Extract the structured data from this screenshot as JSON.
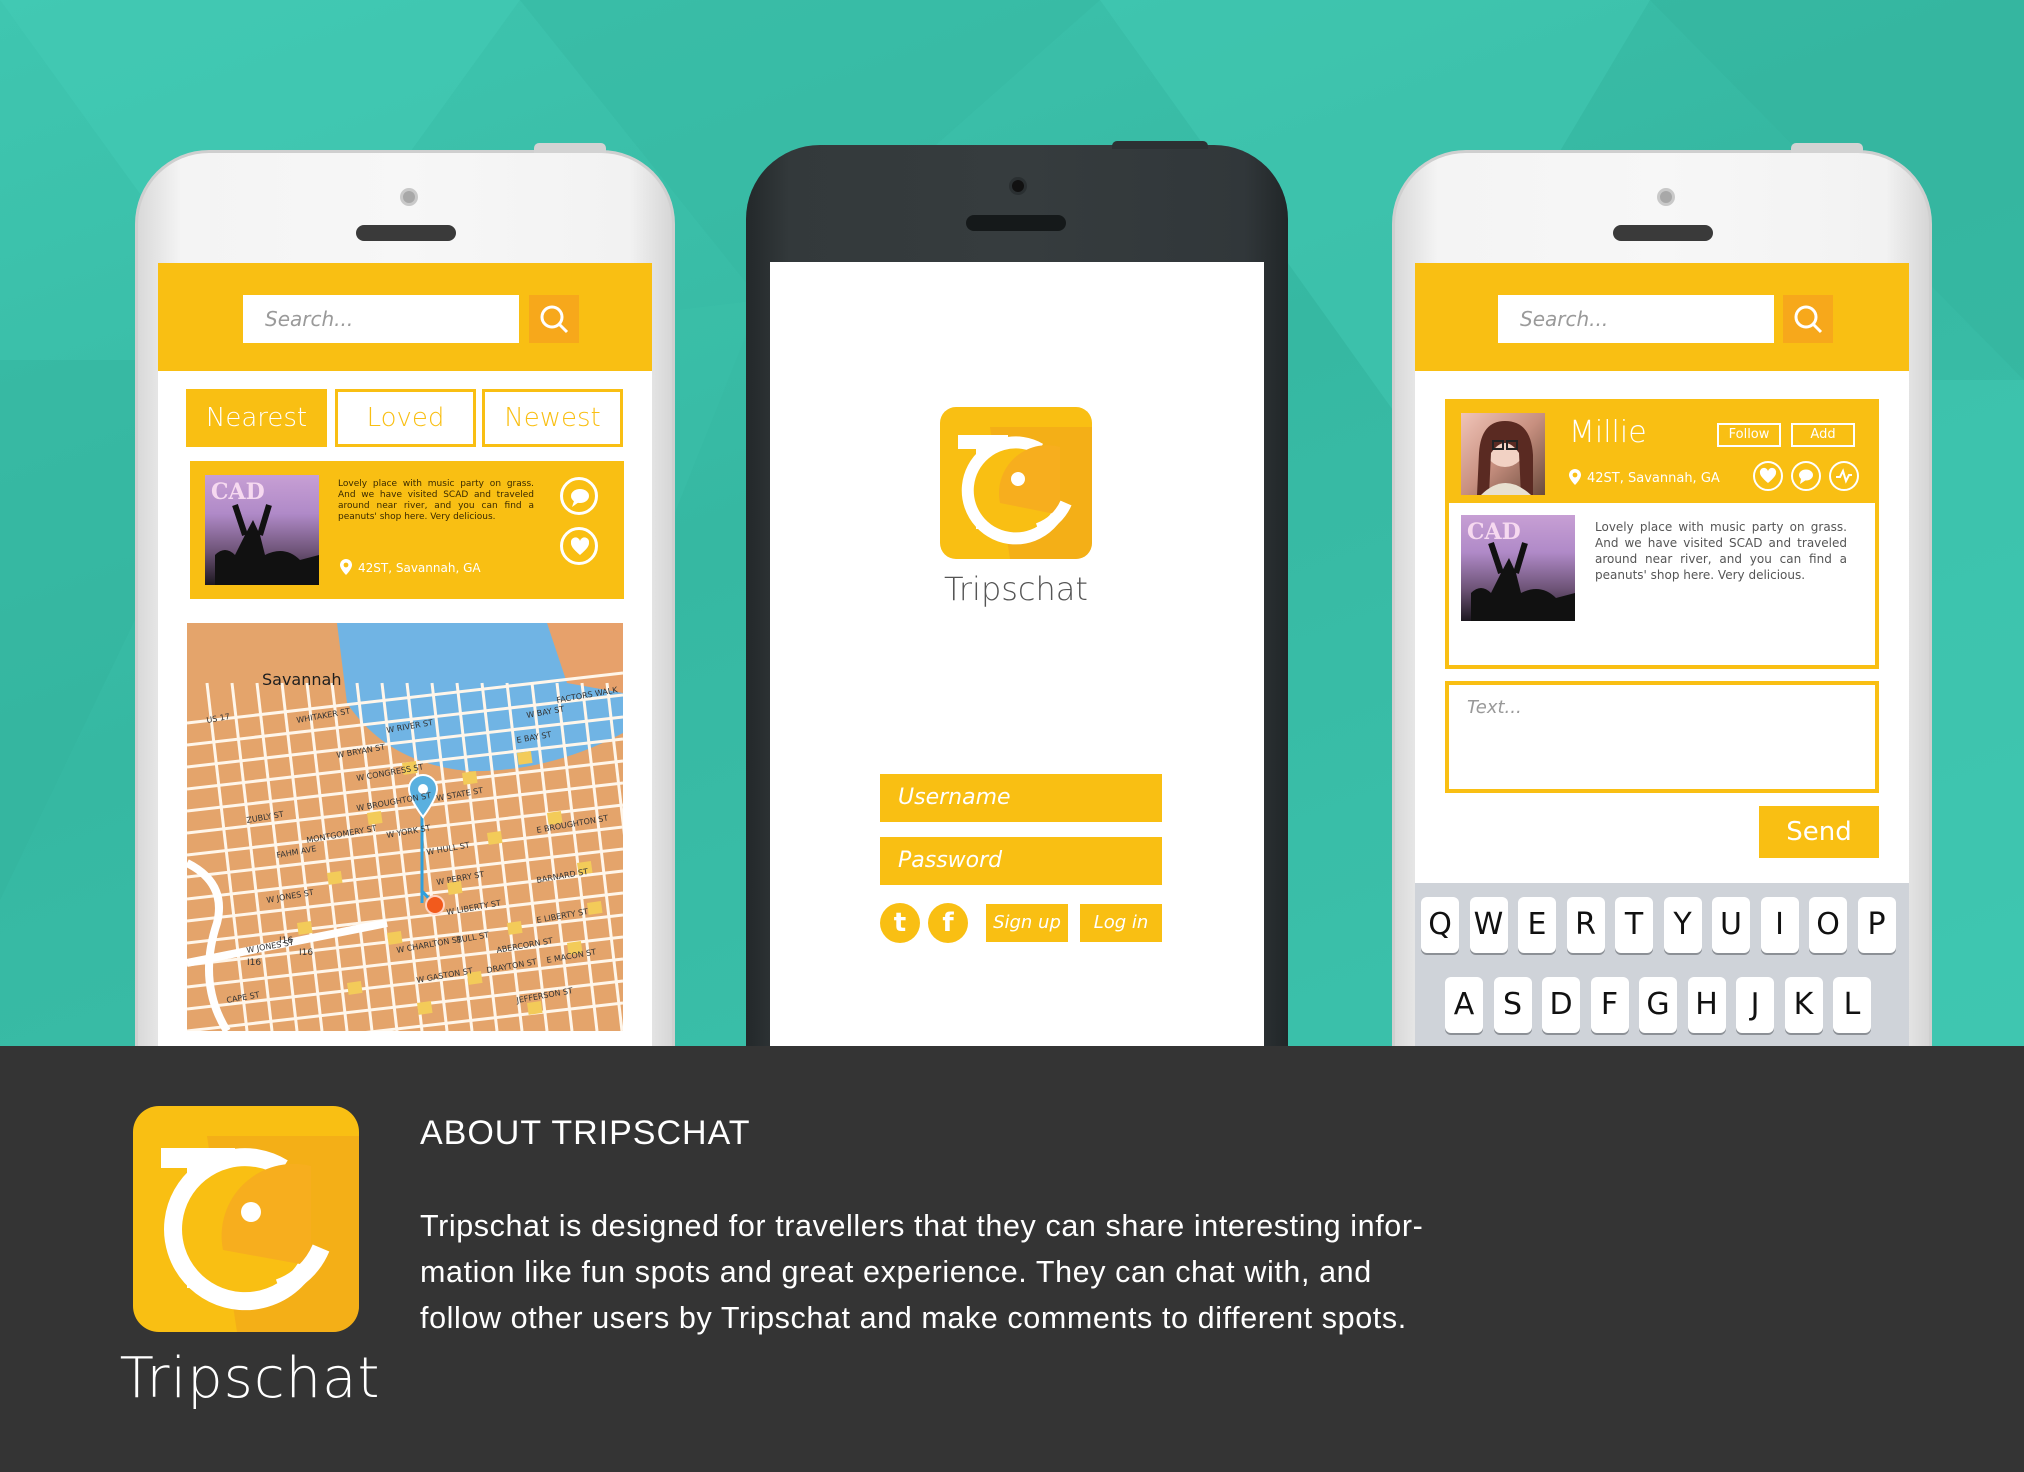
{
  "app": {
    "name": "Tripschat"
  },
  "colors": {
    "accent": "#f9bf13",
    "accent_dark": "#f7a81b",
    "background": "#3bbfaa",
    "footer": "#343434"
  },
  "left_phone": {
    "search_placeholder": "Search...",
    "tabs": [
      {
        "label": "Nearest",
        "active": true
      },
      {
        "label": "Loved",
        "active": false
      },
      {
        "label": "Newest",
        "active": false
      }
    ],
    "post": {
      "image_text": "CAD",
      "description": "Lovely place with music party on grass. And we have visited SCAD and traveled around near river, and you can find a peanuts' shop here. Very delicious.",
      "location": "42ST, Savannah, GA",
      "icons": [
        "comment-icon",
        "heart-icon"
      ]
    },
    "map": {
      "city_label": "Savannah",
      "streets": [
        "W RIVER ST",
        "W BAY ST",
        "W BRYAN ST",
        "W CONGRESS ST",
        "W BROUGHTON ST",
        "W STATE ST",
        "W YORK ST",
        "W HULL ST",
        "W PERRY ST",
        "W LIBERTY ST",
        "W JONES ST",
        "W CHARLTON ST",
        "W GASTON ST",
        "E BAY ST",
        "E BROUGHTON ST",
        "E LIBERTY ST",
        "E MACON ST",
        "FACTORS WALK",
        "BULL ST",
        "ABERCORN ST",
        "DRAYTON ST",
        "MONTGOMERY ST",
        "JEFFERSON ST",
        "BARNARD ST",
        "WHITAKER ST",
        "ZUBLY ST",
        "FAHM AVE",
        "CAPE ST",
        "W JONES ST",
        "US 17"
      ],
      "highway_labels": [
        "I16",
        "I16",
        "I16"
      ]
    }
  },
  "center_phone": {
    "app_title": "Tripschat",
    "username_placeholder": "Username",
    "password_placeholder": "Password",
    "social": {
      "twitter": "t",
      "facebook": "f"
    },
    "signup_label": "Sign up",
    "login_label": "Log in"
  },
  "right_phone": {
    "search_placeholder": "Search...",
    "profile": {
      "name": "Millie",
      "follow_label": "Follow",
      "add_label": "Add",
      "location": "42ST, Savannah, GA",
      "icons": [
        "heart-icon",
        "comment-icon",
        "activity-icon"
      ]
    },
    "post": {
      "image_text": "CAD",
      "description": "Lovely place with music party on grass. And we have visited SCAD and traveled around near river, and you can find a peanuts' shop here. Very delicious."
    },
    "comment_placeholder": "Text...",
    "send_label": "Send",
    "keyboard": {
      "row1": [
        "Q",
        "W",
        "E",
        "R",
        "T",
        "Y",
        "U",
        "I",
        "O",
        "P"
      ],
      "row2": [
        "A",
        "S",
        "D",
        "F",
        "G",
        "H",
        "J",
        "K",
        "L"
      ]
    }
  },
  "footer": {
    "app_name": "Tripschat",
    "about_title": "ABOUT TRIPSCHAT",
    "about_lines": [
      "Tripschat is designed for travellers that they can share interesting infor-",
      "mation like fun spots and great experience. They can chat with, and",
      "follow other users by Tripschat and make comments to different spots."
    ]
  }
}
